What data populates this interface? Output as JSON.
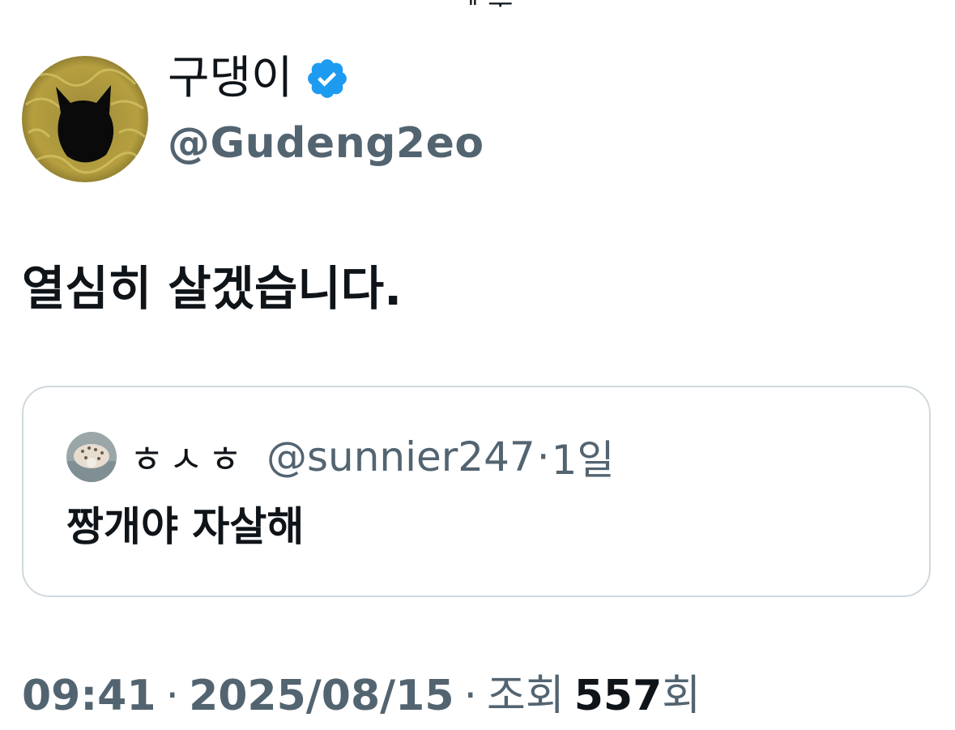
{
  "header_fragment": {
    "left": "ᐟ",
    "middle": "ᅢ ᅮ"
  },
  "author": {
    "display_name": "구댕이",
    "handle": "@Gudeng2eo",
    "verified": true,
    "avatar_icon": "cat-avatar-icon",
    "verified_icon": "verified-badge-icon"
  },
  "tweet": {
    "text": "열심히 살겠습니다."
  },
  "quoted_tweet": {
    "display_name": "ㅎㅅㅎ",
    "handle": "@sunnier247",
    "separator": "·",
    "time": "1일",
    "text": "짱개야 자살해",
    "avatar_icon": "hedgehog-avatar-icon"
  },
  "meta": {
    "time": "09:41",
    "separator": "·",
    "date": "2025/08/15",
    "views_label": "조회",
    "views_count": "557",
    "views_suffix": "회"
  },
  "colors": {
    "text_primary": "#0f1419",
    "text_secondary": "#536471",
    "border": "#cfd9de",
    "verified_blue": "#1d9bf0"
  }
}
